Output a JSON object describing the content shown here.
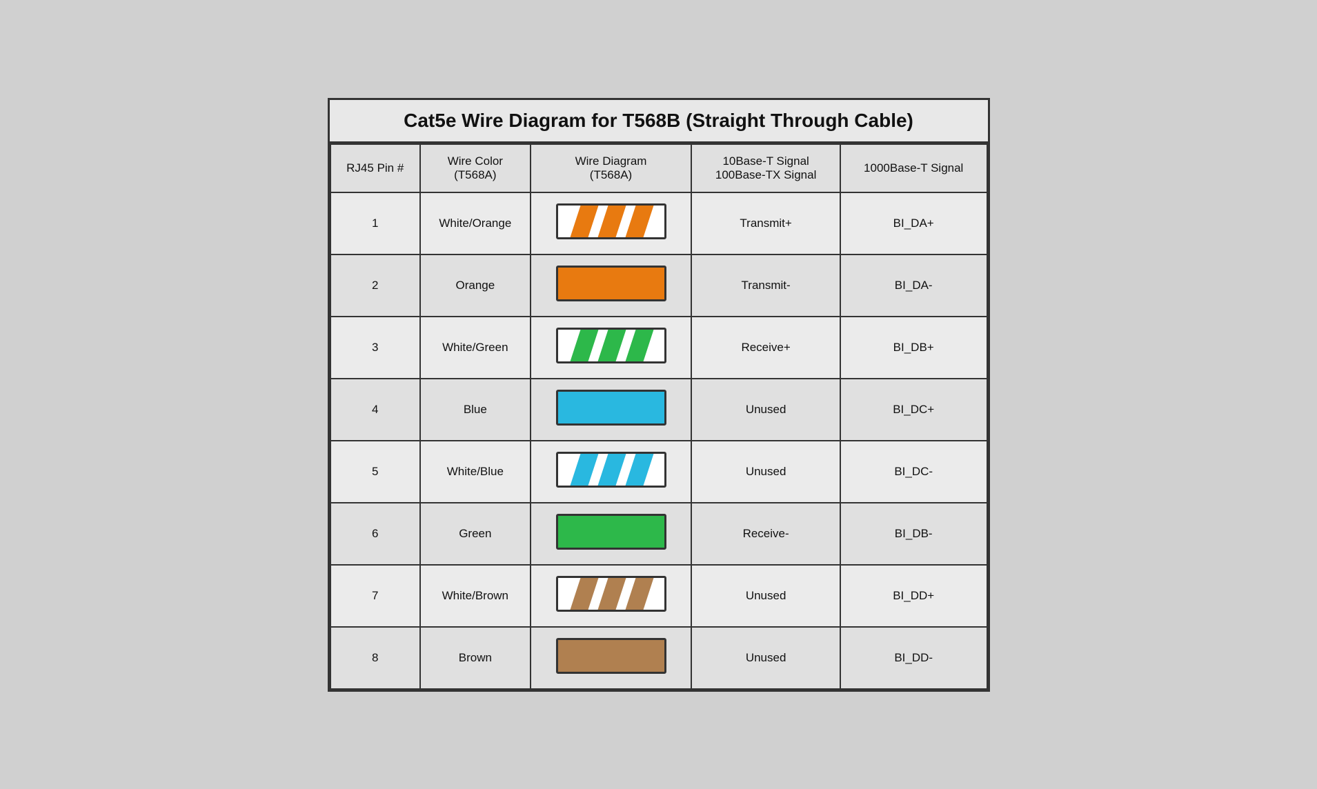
{
  "title": "Cat5e Wire Diagram for T568B (Straight Through Cable)",
  "headers": {
    "col1": "RJ45 Pin #",
    "col2": "Wire Color\n(T568A)",
    "col3": "Wire Diagram\n(T568A)",
    "col4": "10Base-T Signal\n100Base-TX Signal",
    "col5": "1000Base-T Signal"
  },
  "rows": [
    {
      "pin": "1",
      "color_name": "White/Orange",
      "wire_type": "striped",
      "wire_color": "#E87A10",
      "signal_100": "Transmit+",
      "signal_1000": "BI_DA+"
    },
    {
      "pin": "2",
      "color_name": "Orange",
      "wire_type": "solid",
      "wire_color": "#E87A10",
      "signal_100": "Transmit-",
      "signal_1000": "BI_DA-"
    },
    {
      "pin": "3",
      "color_name": "White/Green",
      "wire_type": "striped",
      "wire_color": "#2DB84A",
      "signal_100": "Receive+",
      "signal_1000": "BI_DB+"
    },
    {
      "pin": "4",
      "color_name": "Blue",
      "wire_type": "solid",
      "wire_color": "#29B8E0",
      "signal_100": "Unused",
      "signal_1000": "BI_DC+"
    },
    {
      "pin": "5",
      "color_name": "White/Blue",
      "wire_type": "striped",
      "wire_color": "#29B8E0",
      "signal_100": "Unused",
      "signal_1000": "BI_DC-"
    },
    {
      "pin": "6",
      "color_name": "Green",
      "wire_type": "solid",
      "wire_color": "#2DB84A",
      "signal_100": "Receive-",
      "signal_1000": "BI_DB-"
    },
    {
      "pin": "7",
      "color_name": "White/Brown",
      "wire_type": "striped",
      "wire_color": "#B08050",
      "signal_100": "Unused",
      "signal_1000": "BI_DD+"
    },
    {
      "pin": "8",
      "color_name": "Brown",
      "wire_type": "solid",
      "wire_color": "#B08050",
      "signal_100": "Unused",
      "signal_1000": "BI_DD-"
    }
  ]
}
